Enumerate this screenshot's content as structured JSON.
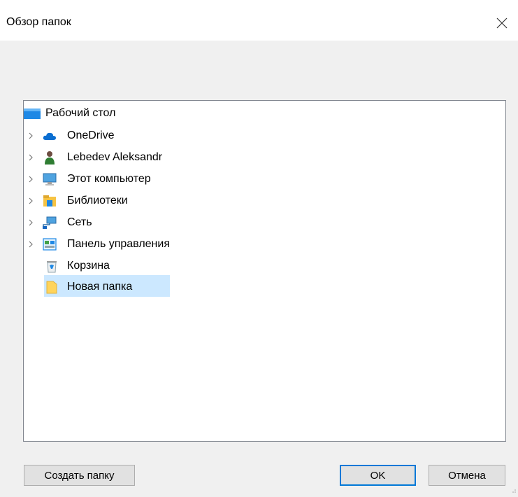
{
  "dialog": {
    "title": "Обзор папок"
  },
  "tree": {
    "root": {
      "label": "Рабочий стол",
      "icon": "desktop-icon"
    },
    "items": [
      {
        "label": "OneDrive",
        "icon": "cloud-icon",
        "expandable": true
      },
      {
        "label": "Lebedev Aleksandr",
        "icon": "user-icon",
        "expandable": true
      },
      {
        "label": "Этот компьютер",
        "icon": "computer-icon",
        "expandable": true
      },
      {
        "label": "Библиотеки",
        "icon": "libraries-icon",
        "expandable": true
      },
      {
        "label": "Сеть",
        "icon": "network-icon",
        "expandable": true
      },
      {
        "label": "Панель управления",
        "icon": "control-panel-icon",
        "expandable": true
      },
      {
        "label": "Корзина",
        "icon": "recycle-bin-icon",
        "expandable": false
      },
      {
        "label": "Новая папка",
        "icon": "folder-icon",
        "expandable": false,
        "selected": true
      }
    ]
  },
  "buttons": {
    "new_folder": "Создать папку",
    "ok": "OK",
    "cancel": "Отмена"
  },
  "colors": {
    "selection": "#cce8ff",
    "accent": "#0078d7",
    "folder": "#ffd45c"
  }
}
